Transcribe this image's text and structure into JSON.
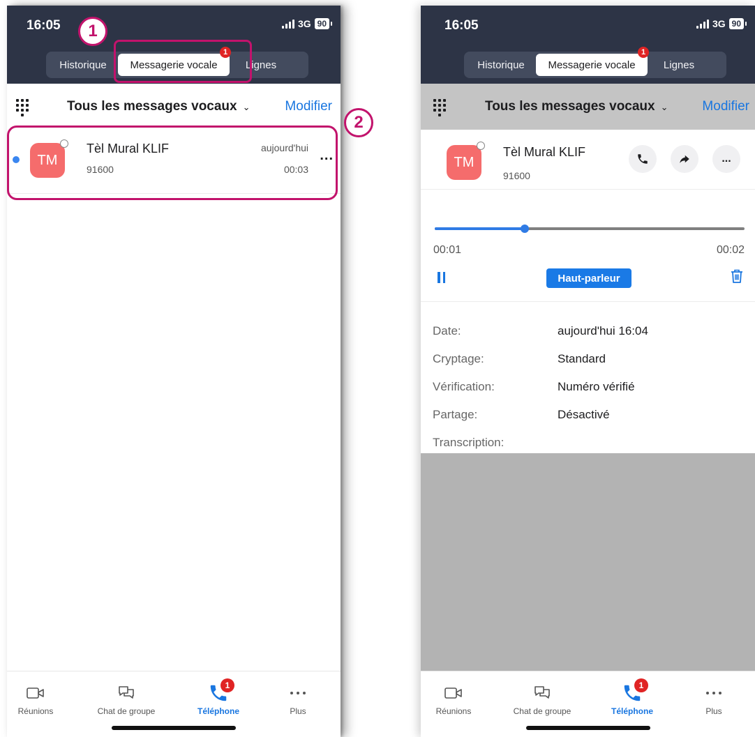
{
  "status": {
    "time": "16:05",
    "network": "3G",
    "battery": "90"
  },
  "tabs": {
    "history": "Historique",
    "voicemail": "Messagerie vocale",
    "lines": "Lignes",
    "voicemail_badge": "1"
  },
  "subheader": {
    "filter": "Tous les messages vocaux",
    "modify": "Modifier"
  },
  "message": {
    "initials": "TM",
    "name": "Tèl Mural KLIF",
    "number": "91600",
    "date": "aujourd'hui",
    "duration": "00:03",
    "more": "..."
  },
  "callouts": {
    "step1": "1",
    "step2": "2"
  },
  "player": {
    "elapsed": "00:01",
    "total": "00:02",
    "progress_fraction": 0.29,
    "speaker_label": "Haut-parleur",
    "more": "..."
  },
  "details": {
    "date_label": "Date:",
    "date_value": "aujourd'hui 16:04",
    "encryption_label": "Cryptage:",
    "encryption_value": "Standard",
    "verification_label": "Vérification:",
    "verification_value": "Numéro vérifié",
    "sharing_label": "Partage:",
    "sharing_value": "Désactivé",
    "transcription_label": "Transcription:"
  },
  "tabbar": {
    "meetings": "Réunions",
    "chat": "Chat de groupe",
    "phone": "Téléphone",
    "more": "Plus",
    "phone_badge": "1"
  },
  "colors": {
    "topbar": "#2d3446",
    "accent": "#1976e0",
    "avatar": "#f56c6c",
    "callout": "#c2136c",
    "badge": "#e02424"
  },
  "icons": [
    "dialpad-icon",
    "chevron-down-icon",
    "video-icon",
    "chat-icon",
    "phone-icon",
    "more-icon",
    "call-icon",
    "share-icon",
    "pause-icon",
    "trash-icon",
    "signal-icon",
    "battery-icon"
  ]
}
